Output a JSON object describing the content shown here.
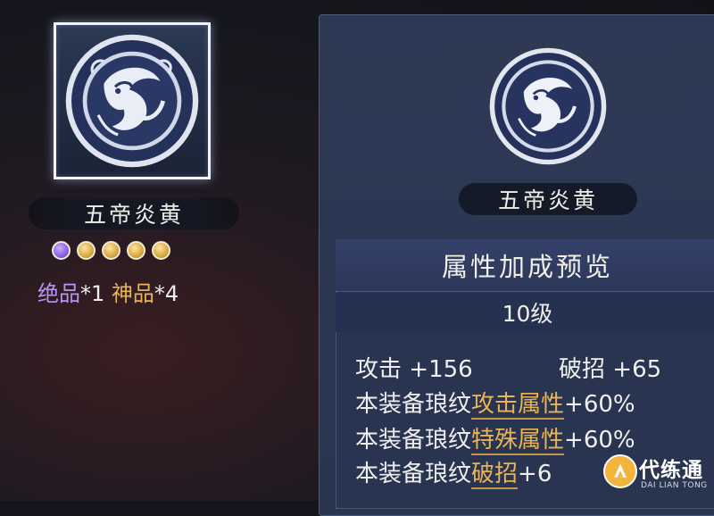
{
  "left": {
    "equip_name": "五帝炎黄",
    "gems": [
      "purple",
      "gold",
      "gold",
      "gold",
      "gold"
    ],
    "grade_parts": [
      {
        "text": "绝品",
        "color": "purple"
      },
      {
        "text": "*1 ",
        "color": "white"
      },
      {
        "text": "神品",
        "color": "gold"
      },
      {
        "text": "*4",
        "color": "white"
      }
    ]
  },
  "right": {
    "equip_name": "五帝炎黄",
    "attr_title": "属性加成预览",
    "level": "10级",
    "stats": [
      {
        "label": "攻击",
        "value": "+156"
      },
      {
        "label": "破招",
        "value": "+65"
      }
    ],
    "bonuses": [
      {
        "prefix": "本装备琅纹",
        "highlight": "攻击属性",
        "value": "+60%"
      },
      {
        "prefix": "本装备琅纹",
        "highlight": "特殊属性",
        "value": "+60%"
      },
      {
        "prefix": "本装备琅纹",
        "highlight": "破招",
        "value": "+6"
      }
    ]
  },
  "watermark": {
    "title": "代练通",
    "subtitle": "DAI LIAN TONG"
  },
  "colors": {
    "purple": "#b496f6",
    "gold": "#e7b45c",
    "panel_bg": "#2e3a55",
    "emblem_blue": "#24315a"
  }
}
